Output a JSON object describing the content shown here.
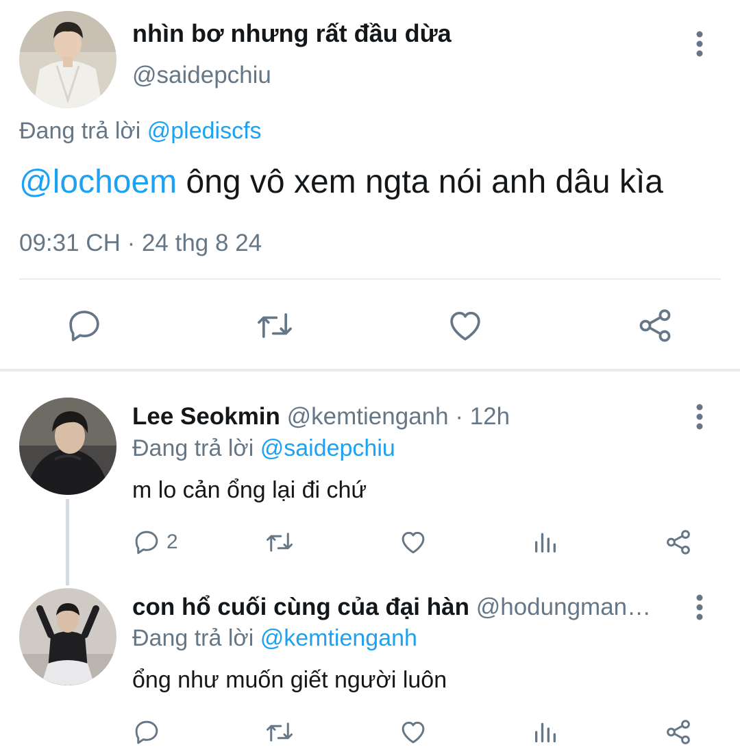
{
  "main_tweet": {
    "display_name": "nhìn bơ nhưng rất đầu dừa",
    "handle": "@saidepchiu",
    "replying_label": "Đang trả lời",
    "replying_to": "@plediscfs",
    "mention": "@lochoem",
    "text": " ông vô xem ngta nói anh dâu kìa",
    "timestamp": "09:31 CH · 24 thg 8 24",
    "actions": [
      "reply-icon",
      "retweet-icon",
      "like-icon",
      "share-icon"
    ]
  },
  "replies": [
    {
      "display_name": "Lee Seokmin",
      "handle": "@kemtienganh",
      "time": " · 12h",
      "replying_label": "Đang trả lời",
      "replying_to": "@saidepchiu",
      "text": "m lo cản ổng lại đi chứ",
      "reply_count": "2"
    },
    {
      "display_name": "con hổ cuối cùng của đại hàn",
      "handle": "@hodungman…",
      "replying_label": "Đang trả lời",
      "replying_to": "@kemtienganh",
      "text": "ổng như muốn giết người luôn",
      "reply_count": ""
    }
  ],
  "colors": {
    "accent": "#1da1f2",
    "muted": "#657786",
    "text": "#14171a",
    "divider": "#e6ecf0"
  }
}
